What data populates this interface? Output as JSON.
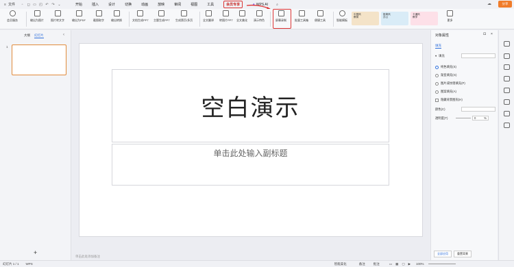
{
  "quickbar": {
    "file": "文件"
  },
  "tabs": [
    "开始",
    "插入",
    "设计",
    "切换",
    "动画",
    "放映",
    "审阅",
    "视图",
    "工具"
  ],
  "highlighted_tab": "会员专享",
  "ai_tab": "WPS AI",
  "share_label": "分享",
  "ribbon": {
    "items": [
      "会员服务",
      "输出为图片",
      "图片转文字",
      "输出为PDF",
      "截图取字",
      "输出转换",
      "文档生成PPT",
      "主题生成PPT",
      "生成第页/多页",
      "全文翻译",
      "转图片PPT",
      "全文美化",
      "演示特色",
      "屏幕录制",
      "批量工具箱",
      "便捷工具",
      "智能模板",
      "更多"
    ],
    "highlighted_item": "屏幕录制",
    "templates": [
      {
        "text": "中国风\n教育",
        "color": "#f4e3c8"
      },
      {
        "text": "极简风\n办公",
        "color": "#d9ecf7"
      },
      {
        "text": "卡通风\n教学",
        "color": "#fde0e8"
      }
    ]
  },
  "left_pane": {
    "tab_outline": "大纲",
    "tab_slides": "幻灯片",
    "slide_number": "1",
    "add_icon": "+"
  },
  "slide": {
    "title": "空白演示",
    "subtitle": "单击此处输入副标题"
  },
  "notes_placeholder": "单击此处添加备注",
  "right_pane": {
    "title": "对象属性",
    "tab": "填充",
    "section": "填充",
    "options": [
      "纯色填充(S)",
      "渐变填充(G)",
      "图片或纹理填充(P)",
      "图案填充(A)"
    ],
    "selected_option": "纯色填充(S)",
    "checkbox": "隐藏背景图形(H)",
    "color_label": "颜色(C)",
    "transparency_label": "透明度(T)",
    "transparency_value": "0",
    "transparency_unit": "%",
    "buttons": [
      "全部应用",
      "重置背景"
    ]
  },
  "status": {
    "slide_info": "幻灯片 1 / 1",
    "app": "WPS",
    "beautify": "智能美化",
    "notes": "备注",
    "comment": "批注",
    "zoom": "100%"
  }
}
